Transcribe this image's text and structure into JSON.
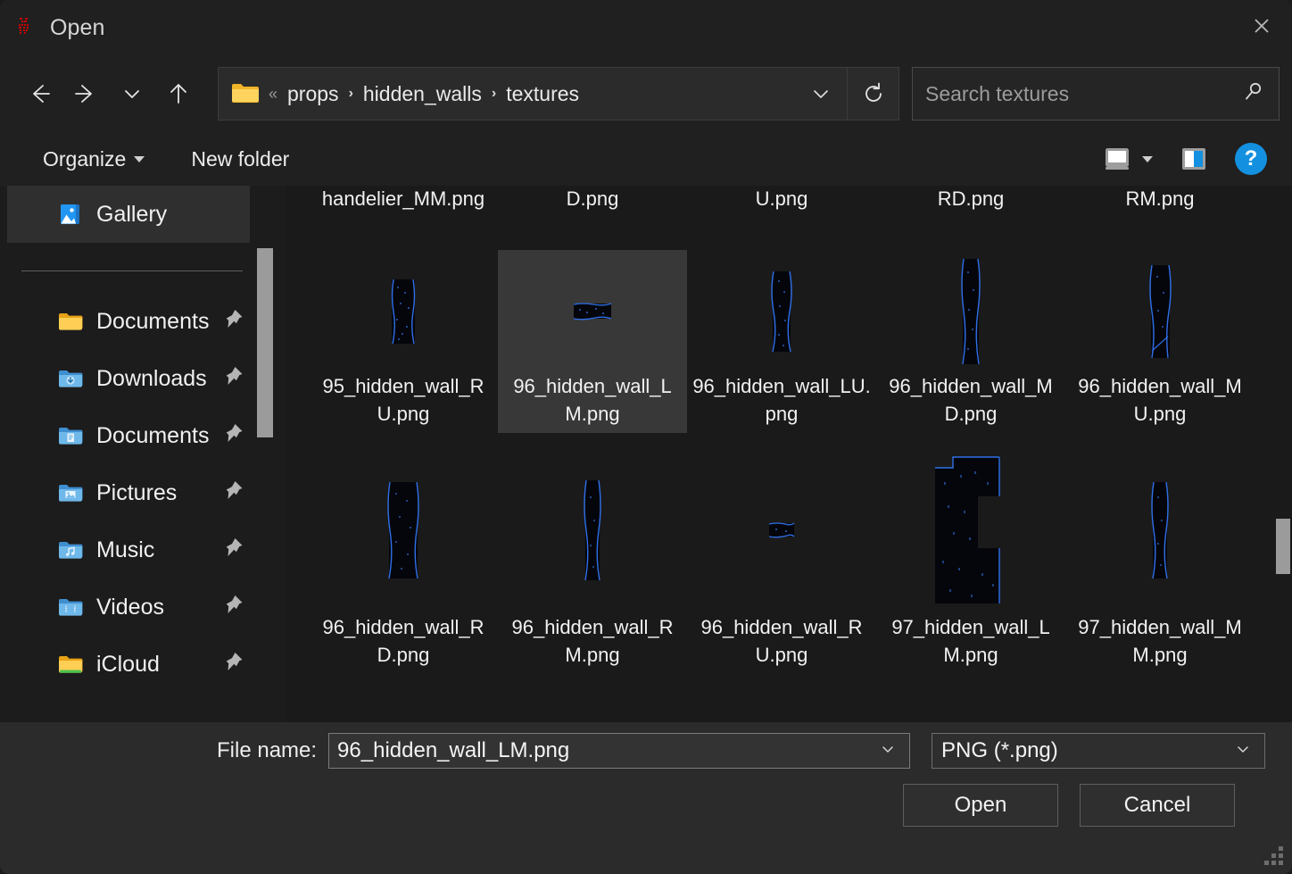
{
  "window": {
    "title": "Open",
    "app_icon": "app-logo-icon",
    "close_label": "✕"
  },
  "nav": {
    "back_icon": "arrow-left-icon",
    "forward_icon": "arrow-right-icon",
    "recent_icon": "chevron-down-icon",
    "up_icon": "arrow-up-icon",
    "breadcrumb": {
      "folder_icon": "folder-icon",
      "overflow": "«",
      "segments": [
        "props",
        "hidden_walls",
        "textures"
      ],
      "separator": "›",
      "dropdown_icon": "chevron-down-icon"
    },
    "refresh_icon": "refresh-icon",
    "search": {
      "placeholder": "Search textures",
      "value": "",
      "icon": "search-icon"
    }
  },
  "commandbar": {
    "organize_label": "Organize",
    "new_folder_label": "New folder",
    "view_icon": "view-layout-icon",
    "view_caret_icon": "chevron-down-icon",
    "preview_pane_icon": "preview-pane-icon",
    "help_label": "?"
  },
  "sidebar": {
    "gallery": {
      "label": "Gallery",
      "icon": "gallery-icon",
      "selected": true
    },
    "items": [
      {
        "label": "Documents",
        "icon": "folder-yellow-icon",
        "pinned": true
      },
      {
        "label": "Downloads",
        "icon": "folder-downloads-icon",
        "pinned": true
      },
      {
        "label": "Documents",
        "icon": "folder-documents-icon",
        "pinned": true
      },
      {
        "label": "Pictures",
        "icon": "folder-pictures-icon",
        "pinned": true
      },
      {
        "label": "Music",
        "icon": "folder-music-icon",
        "pinned": true
      },
      {
        "label": "Videos",
        "icon": "folder-videos-icon",
        "pinned": true
      },
      {
        "label": "iCloud",
        "icon": "folder-icloud-icon",
        "pinned": true
      }
    ],
    "pin_icon": "pin-icon"
  },
  "files": {
    "clipped_row": [
      {
        "label": "handelier_MM.png"
      },
      {
        "label": "D.png"
      },
      {
        "label": "U.png"
      },
      {
        "label": "RD.png"
      },
      {
        "label": "RM.png"
      }
    ],
    "rows": [
      [
        {
          "label": "95_hidden_wall_RU.png",
          "selected": false,
          "thumb": "wall-narrow"
        },
        {
          "label": "96_hidden_wall_LM.png",
          "selected": true,
          "thumb": "wall-stub"
        },
        {
          "label": "96_hidden_wall_LU.png",
          "selected": false,
          "thumb": "wall-narrow"
        },
        {
          "label": "96_hidden_wall_MD.png",
          "selected": false,
          "thumb": "wall-tall"
        },
        {
          "label": "96_hidden_wall_MU.png",
          "selected": false,
          "thumb": "wall-tall"
        }
      ],
      [
        {
          "label": "96_hidden_wall_RD.png",
          "selected": false,
          "thumb": "wall-wide"
        },
        {
          "label": "96_hidden_wall_RM.png",
          "selected": false,
          "thumb": "wall-narrow"
        },
        {
          "label": "96_hidden_wall_RU.png",
          "selected": false,
          "thumb": "wall-stub"
        },
        {
          "label": "97_hidden_wall_LM.png",
          "selected": false,
          "thumb": "wall-block"
        },
        {
          "label": "97_hidden_wall_MM.png",
          "selected": false,
          "thumb": "wall-narrow"
        }
      ]
    ]
  },
  "footer": {
    "filename_label": "File name:",
    "filename_value": "96_hidden_wall_LM.png",
    "filename_caret_icon": "chevron-down-icon",
    "filetype_value": "PNG (*.png)",
    "filetype_caret_icon": "chevron-down-icon",
    "open_label": "Open",
    "cancel_label": "Cancel",
    "resize_grip_icon": "resize-grip-icon"
  },
  "colors": {
    "window_bg": "#202020",
    "grid_bg": "#1a1a1a",
    "sidebar_bg": "#1c1c1c",
    "footer_bg": "#2b2b2b",
    "selection": "#383838",
    "accent": "#1490e0",
    "texture_outline": "#2a6ce0"
  }
}
